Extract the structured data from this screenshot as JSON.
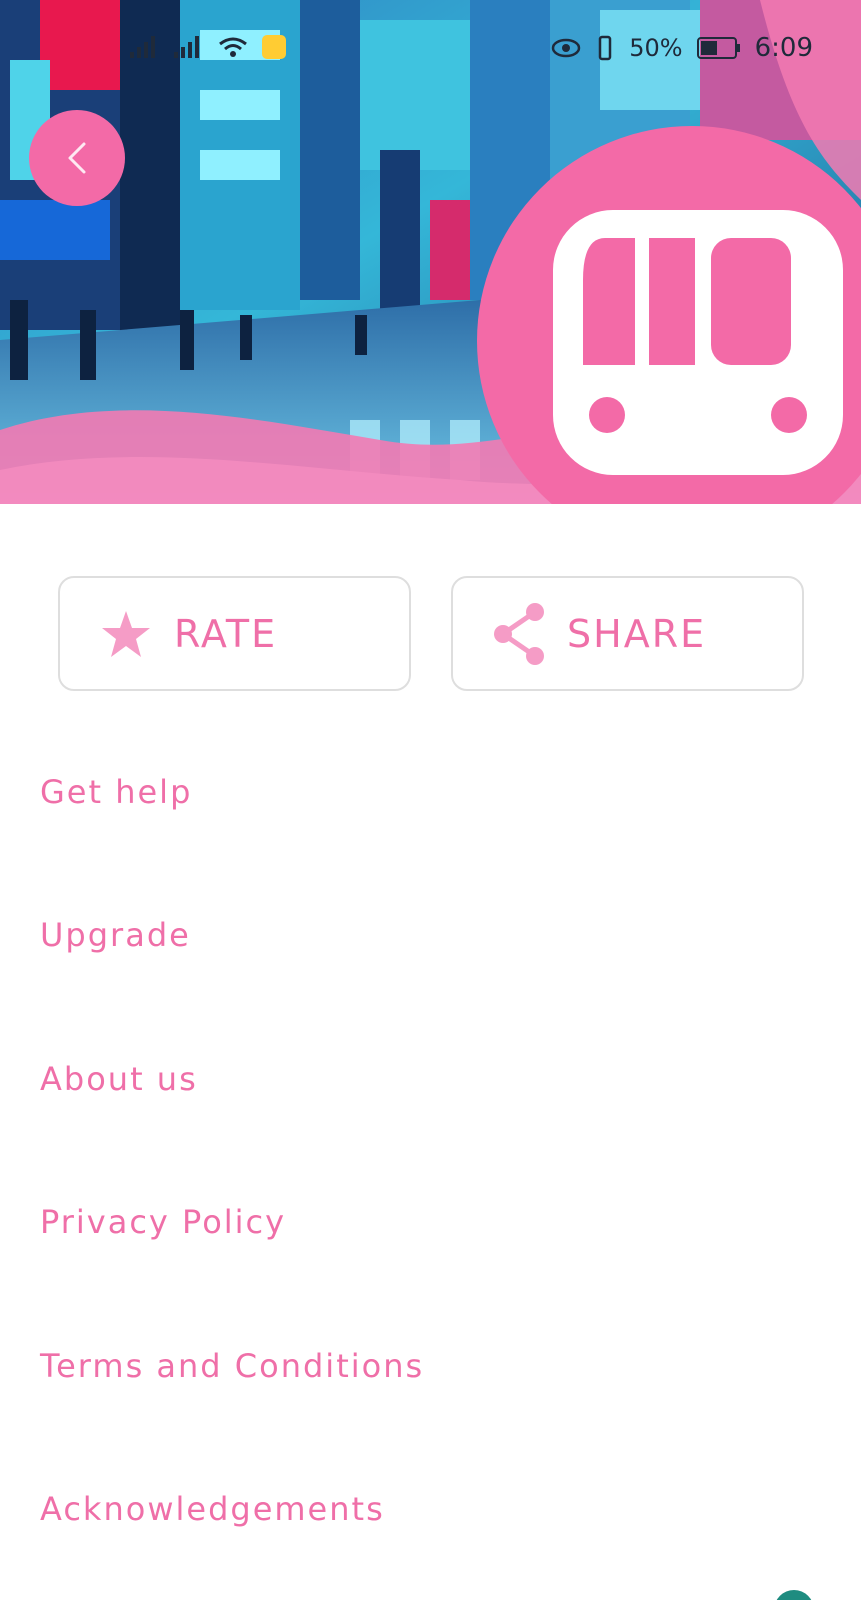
{
  "status_bar": {
    "time": "6:09",
    "battery": "50%",
    "icons": [
      "signal-icon",
      "signal-icon",
      "wifi-icon",
      "notification-icon",
      "eye-icon",
      "vibrate-icon",
      "battery-icon"
    ]
  },
  "header": {
    "back_icon": "chevron-left-icon",
    "app_icon": "train-icon",
    "accent": "#f36aa7"
  },
  "actions": {
    "rate": {
      "label": "RATE",
      "icon": "star-icon"
    },
    "share": {
      "label": "SHARE",
      "icon": "share-icon"
    }
  },
  "menu": {
    "items": [
      {
        "label": "Get help"
      },
      {
        "label": "Upgrade"
      },
      {
        "label": "About us"
      },
      {
        "label": "Privacy Policy"
      },
      {
        "label": "Terms and Conditions"
      },
      {
        "label": "Acknowledgements"
      }
    ]
  },
  "colors": {
    "accent": "#f36aa7",
    "text_accent": "#ef6fa8",
    "border": "#dedede"
  }
}
